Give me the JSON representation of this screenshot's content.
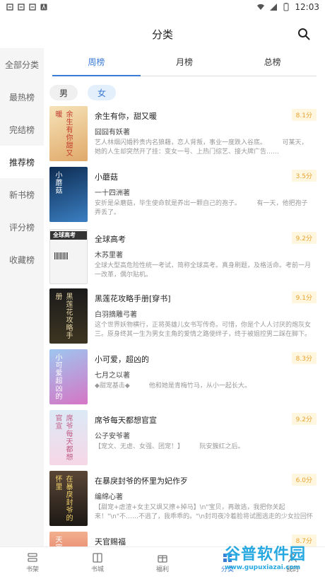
{
  "status": {
    "time": "12:03"
  },
  "header": {
    "title": "分类"
  },
  "sidebar": {
    "items": [
      {
        "label": "全部分类",
        "active": false
      },
      {
        "label": "最热榜",
        "active": false
      },
      {
        "label": "完结榜",
        "active": false
      },
      {
        "label": "推荐榜",
        "active": true
      },
      {
        "label": "新书榜",
        "active": false
      },
      {
        "label": "评分榜",
        "active": false
      },
      {
        "label": "收藏榜",
        "active": false
      }
    ]
  },
  "tabs": [
    {
      "label": "周榜",
      "active": true
    },
    {
      "label": "月榜",
      "active": false
    },
    {
      "label": "总榜",
      "active": false
    }
  ],
  "gender": [
    {
      "label": "男",
      "active": false
    },
    {
      "label": "女",
      "active": true
    }
  ],
  "books": [
    {
      "title": "余生有你，甜又暖",
      "author": "囧囧有妖著",
      "score": "8.1分",
      "desc": "艺人林烟闪婚矜贵内名狼藉，恋人背叛，事业一度跌入谷底。　　　可某天，她的人生却突然开了挂：变女一号、上热门综艺、接大牌广告……",
      "color": "#f1d7a0",
      "cover_text": "余生有你甜又暖"
    },
    {
      "title": "小蘑菇",
      "author": "一十四洲著",
      "score": "3.5分",
      "desc": "安折是朵蘑菇，毕生使命就是养出一颗自己的孢子。　　　有一天，他把孢子弄丢了。",
      "color": "#1d4f86",
      "cover_text": "小蘑菇"
    },
    {
      "title": "全球高考",
      "author": "木苏里著",
      "score": "9.2分",
      "desc": "全球大型高危险性统一考试，简称全球高考。真身刷题，及格活命。考前一月一改革，偶尔贴机。",
      "color": "#ededed",
      "cover_text": "全球高考"
    },
    {
      "title": "黑莲花攻略手册[穿书]",
      "author": "白羽摘雕弓著",
      "score": "9.1分",
      "desc": "这个世界妖物横行，正将英雄儿女书写传奇。可惜，你是个人人讨厌的炮灰女三。原身终其一生为男女主角的爱情之路使绊子，终于被姐控男二踩在脚下。",
      "color": "#2b2b2b",
      "cover_text": "黑莲花攻略手册"
    },
    {
      "title": "小可爱，超凶的",
      "author": "七月之以著",
      "score": "8.3分",
      "desc": "◆甜宠基击◆　　　他和她是青梅竹马，从小一起长大。",
      "color": "#c66cc9",
      "cover_text": "小可爱超凶的"
    },
    {
      "title": "席爷每天都想官宣",
      "author": "公子安爷著",
      "score": "9.2分",
      "desc": "【宠文、无虐、女强、团宠！】　　　阮安簇红之后。",
      "color": "#cfe0f2",
      "cover_text": "席爷每天都想官宣"
    },
    {
      "title": "在暴戾封爷的怀里为妃作歹",
      "author": "编绵心著",
      "score": "6.0分",
      "desc": "【甜宠+虐渣+女主又飒又撩+掉马】\\n\"宝贝，再敢逃，我把你关起来！\"\\n\"不……不逃了，我乖乖的。\"\\n封司夜冷着脸将试图逃走的少女拉回怀中。",
      "color": "#3b2a22",
      "cover_text": "在暴戾封爷的怀里"
    },
    {
      "title": "天官赐福",
      "author": "",
      "score": "8.7分",
      "desc": "",
      "color": "#d94f3f",
      "cover_text": "天官赐福"
    }
  ],
  "bottom": [
    {
      "label": "书架",
      "icon": "bookshelf-icon",
      "active": false
    },
    {
      "label": "书城",
      "icon": "book-icon",
      "active": false
    },
    {
      "label": "福利",
      "icon": "gift-icon",
      "active": false
    },
    {
      "label": "分类",
      "icon": "category-icon",
      "active": true
    },
    {
      "label": "我的",
      "icon": "user-icon",
      "active": false
    }
  ],
  "watermark": {
    "main": "谷普软件园",
    "url": "www.gupuxiazai.com"
  }
}
